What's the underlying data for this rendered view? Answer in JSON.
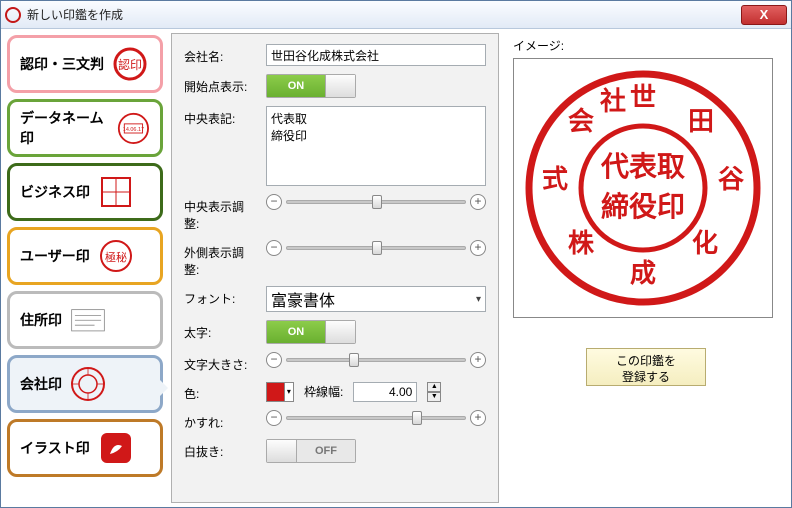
{
  "window": {
    "title": "新しい印鑑を作成"
  },
  "sidebar": {
    "items": [
      {
        "label": "認印・三文判"
      },
      {
        "label": "データネーム印"
      },
      {
        "label": "ビジネス印"
      },
      {
        "label": "ユーザー印"
      },
      {
        "label": "住所印"
      },
      {
        "label": "会社印"
      },
      {
        "label": "イラスト印"
      }
    ]
  },
  "form": {
    "company_label": "会社名:",
    "company_value": "世田谷化成株式会社",
    "startpoint_label": "開始点表示:",
    "startpoint_on": "ON",
    "center_label": "中央表記:",
    "center_value": "代表取\n締役印",
    "center_adjust_label": "中央表示調整:",
    "outer_adjust_label": "外側表示調整:",
    "font_label": "フォント:",
    "font_value": "富豪書体",
    "bold_label": "太字:",
    "bold_on": "ON",
    "size_label": "文字大きさ:",
    "color_label": "色:",
    "color_value": "#d01818",
    "border_label": "枠線幅:",
    "border_value": "4.00",
    "blur_label": "かすれ:",
    "punch_label": "白抜き:",
    "punch_off": "OFF"
  },
  "preview": {
    "label": "イメージ:",
    "register": "この印鑑を\n登録する"
  }
}
